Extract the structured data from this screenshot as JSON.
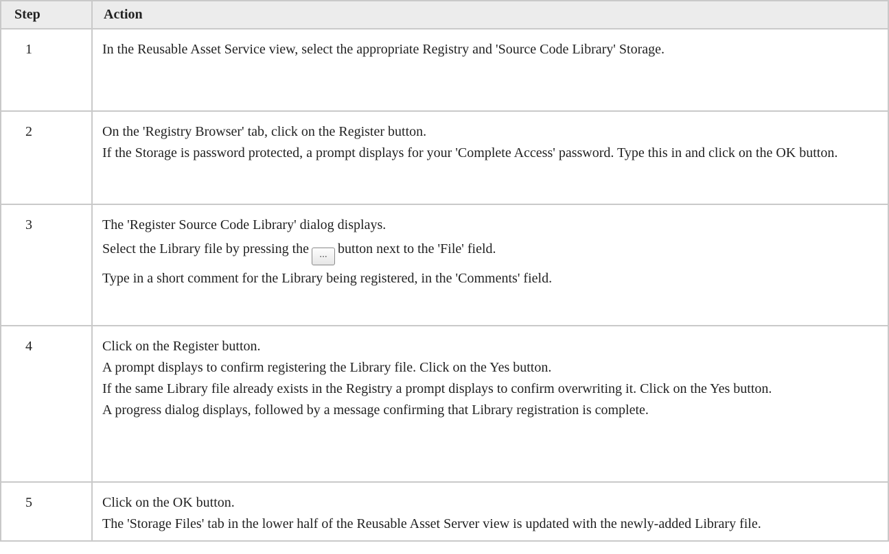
{
  "table": {
    "headers": {
      "step": "Step",
      "action": "Action"
    },
    "rows": [
      {
        "step": "1",
        "lines": [
          "In the Reusable Asset Service view, select the appropriate Registry and 'Source Code Library' Storage."
        ]
      },
      {
        "step": "2",
        "lines": [
          "On the 'Registry Browser' tab, click on the Register button.",
          "If the Storage is password protected, a prompt displays for your 'Complete Access' password. Type this in and click on the OK button."
        ]
      },
      {
        "step": "3",
        "lines": [
          "The 'Register Source Code Library' dialog displays.",
          "Type in a short comment for the Library being registered, in the 'Comments' field."
        ],
        "file_line": {
          "before": "Select the Library file by pressing the",
          "button": "...",
          "after": "button next to the 'File' field."
        }
      },
      {
        "step": "4",
        "lines": [
          "Click on the Register button.",
          "A prompt displays to confirm registering the Library file. Click on the Yes button.",
          "If the same Library file already exists in the Registry a prompt displays to confirm overwriting it. Click on the Yes button.",
          "A progress dialog displays, followed by a message confirming that Library registration is complete."
        ]
      },
      {
        "step": "5",
        "lines": [
          "Click on the OK button.",
          "The 'Storage Files' tab in the lower half of the Reusable Asset Server view is updated with the newly-added Library file."
        ]
      }
    ]
  }
}
